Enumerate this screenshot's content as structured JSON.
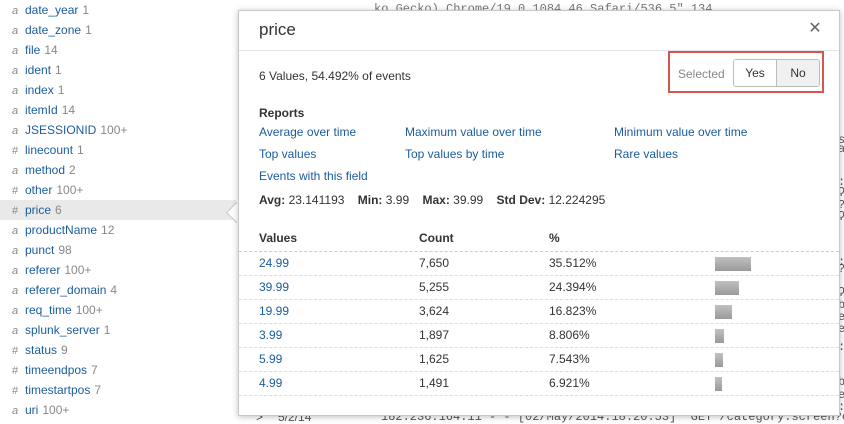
{
  "fields": [
    {
      "type": "a",
      "name": "date_year",
      "count": "1"
    },
    {
      "type": "a",
      "name": "date_zone",
      "count": "1"
    },
    {
      "type": "a",
      "name": "file",
      "count": "14"
    },
    {
      "type": "a",
      "name": "ident",
      "count": "1"
    },
    {
      "type": "a",
      "name": "index",
      "count": "1"
    },
    {
      "type": "a",
      "name": "itemId",
      "count": "14"
    },
    {
      "type": "a",
      "name": "JSESSIONID",
      "count": "100+"
    },
    {
      "type": "#",
      "name": "linecount",
      "count": "1"
    },
    {
      "type": "a",
      "name": "method",
      "count": "2"
    },
    {
      "type": "#",
      "name": "other",
      "count": "100+"
    },
    {
      "type": "#",
      "name": "price",
      "count": "6"
    },
    {
      "type": "a",
      "name": "productName",
      "count": "12"
    },
    {
      "type": "a",
      "name": "punct",
      "count": "98"
    },
    {
      "type": "a",
      "name": "referer",
      "count": "100+"
    },
    {
      "type": "a",
      "name": "referer_domain",
      "count": "4"
    },
    {
      "type": "a",
      "name": "req_time",
      "count": "100+"
    },
    {
      "type": "a",
      "name": "splunk_server",
      "count": "1"
    },
    {
      "type": "#",
      "name": "status",
      "count": "9"
    },
    {
      "type": "#",
      "name": "timeendpos",
      "count": "7"
    },
    {
      "type": "#",
      "name": "timestartpos",
      "count": "7"
    },
    {
      "type": "a",
      "name": "uri",
      "count": "100+"
    }
  ],
  "background": {
    "line1": "ko Gecko) Chrome/19.0.1084.46 Safari/536.5\" 134",
    "right_fragments": [
      "s",
      "a",
      ":",
      "ʔ",
      "?",
      "ʔ",
      ":",
      "?",
      "ʔ",
      "b",
      "e",
      "e",
      ":",
      "b",
      "e",
      ":"
    ],
    "bottom_date": "5/2/14",
    "bottom_event": "182.236.164.11 - - [02/May/2014:18:20:53] \"GET /category.screen?c",
    "bottom_arrow": ">"
  },
  "popup": {
    "title": "price",
    "close_glyph": "✕",
    "summary": "6 Values, 54.492% of events",
    "selected_label": "Selected",
    "yes_label": "Yes",
    "no_label": "No",
    "reports_heading": "Reports",
    "reports": {
      "avg": "Average over time",
      "max": "Maximum value over time",
      "min": "Minimum value over time",
      "top": "Top values",
      "top_time": "Top values by time",
      "rare": "Rare values",
      "events": "Events with this field"
    },
    "stats": {
      "avg_label": "Avg:",
      "avg": "23.141193",
      "min_label": "Min:",
      "min": "3.99",
      "max_label": "Max:",
      "max": "39.99",
      "std_label": "Std Dev:",
      "std": "12.224295"
    },
    "table": {
      "headers": {
        "values": "Values",
        "count": "Count",
        "pct": "%"
      },
      "rows": [
        {
          "value": "24.99",
          "count": "7,650",
          "pct": "35.512%",
          "fraction": 0.35512
        },
        {
          "value": "39.99",
          "count": "5,255",
          "pct": "24.394%",
          "fraction": 0.24394
        },
        {
          "value": "19.99",
          "count": "3,624",
          "pct": "16.823%",
          "fraction": 0.16823
        },
        {
          "value": "3.99",
          "count": "1,897",
          "pct": "8.806%",
          "fraction": 0.08806
        },
        {
          "value": "5.99",
          "count": "1,625",
          "pct": "7.543%",
          "fraction": 0.07543
        },
        {
          "value": "4.99",
          "count": "1,491",
          "pct": "6.921%",
          "fraction": 0.06921
        }
      ]
    }
  }
}
